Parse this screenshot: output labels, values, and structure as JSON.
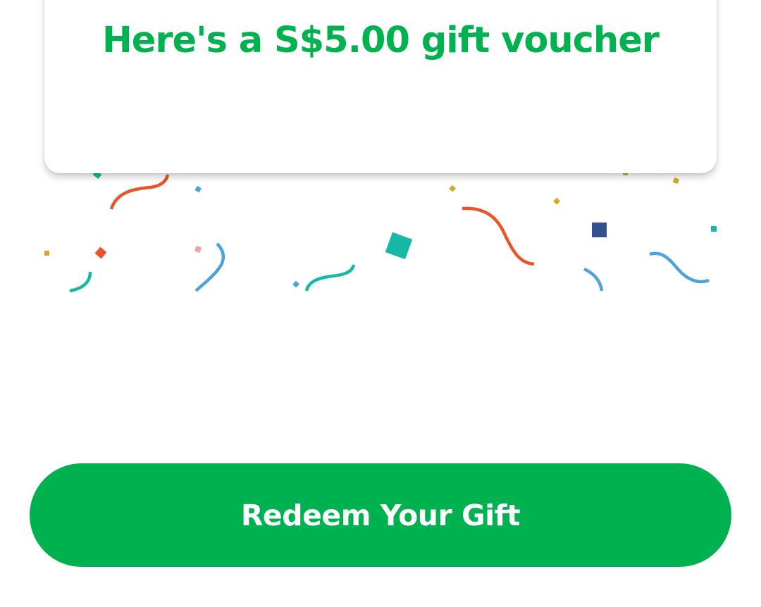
{
  "voucher_card": {
    "title": "Here's a S$5.00 gift voucher"
  },
  "redeem_button": {
    "label": "Redeem Your Gift"
  },
  "colors": {
    "brand_green": "#00b14f",
    "confetti_orange": "#e8542b",
    "confetti_teal": "#16b9a6",
    "confetti_blue": "#4ea3dc",
    "confetti_navy": "#34508f",
    "confetti_gold": "#d2a82a",
    "confetti_pink": "#f0a4a4"
  }
}
